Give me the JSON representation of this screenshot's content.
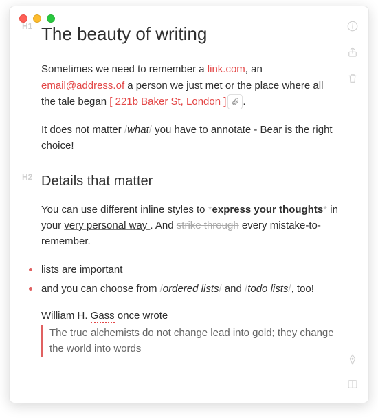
{
  "gutters": {
    "h1": "H1",
    "h2": "H2"
  },
  "title": "The beauty of writing",
  "para1": {
    "t1": "Sometimes we need to remember a ",
    "link": "link.com",
    "t2": ", an ",
    "email": "email@address.of",
    "t3": " a person we just met or the place where all the tale began ",
    "lbracket": "[ ",
    "address": "221b Baker St, London ",
    "rbracket": "]",
    "attach": "( 📎 )",
    "t4": "."
  },
  "para2": {
    "t1": "It does not matter ",
    "sl1": "/",
    "it1": "what",
    "sl2": "/",
    "t2": " you have to annotate - Bear is the right choice!"
  },
  "subtitle": "Details that matter",
  "para3": {
    "t1": "You can use different inline styles to ",
    "m1": "*",
    "bold": "express your thoughts",
    "m2": "*",
    "t2": " in your  ",
    "u": "very personal way ",
    "t3": " . And  ",
    "strike": "strike through",
    "t4": "  every mistake-to-remember."
  },
  "bullets": {
    "b1": "lists are important",
    "b2": {
      "t1": "and you can choose from ",
      "sl1": "/",
      "it1": "ordered lists",
      "sl2": "/",
      "t2": " and ",
      "sl3": "/",
      "it2": "todo lists",
      "sl4": "/",
      "t3": ", too!"
    }
  },
  "author": {
    "t1": "William H. ",
    "mark": "Gass",
    "t2": " once wrote"
  },
  "quote": "The true alchemists do not change lead into gold; they change the world into words",
  "icons": {
    "info": "info-icon",
    "share": "share-icon",
    "trash": "trash-icon",
    "pen": "pen-icon",
    "panel": "panel-icon"
  }
}
